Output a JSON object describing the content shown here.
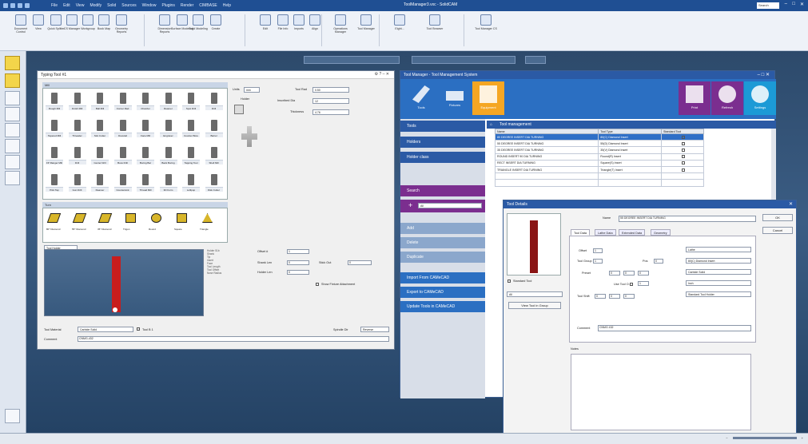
{
  "app": {
    "title": "ToolManager3.vxc - SolidCAM",
    "menu": [
      "File",
      "Edit",
      "View",
      "Modify",
      "Solid",
      "Sources",
      "Window",
      "Plugins",
      "Render",
      "CIMBASE",
      "Help"
    ],
    "search": "Search"
  },
  "ribbon": {
    "buttons": [
      "Document Control",
      "View",
      "Quick Splitter",
      "CS Manager",
      "Workgroup",
      "Book Map",
      "Geometry Reports",
      "Dimension Reports",
      "Surface Modeling",
      "Solid Modeling",
      "Create",
      "Edit",
      "File Info",
      "Imports",
      "Align",
      "Operations Manager",
      "Tool Manager",
      "Eight...",
      "Tool Browser",
      "Tool Manager CS"
    ]
  },
  "typing_window": {
    "title": "Typing Tool #1",
    "mill_label": "Mill",
    "turn_label": "Turn",
    "holder_dropdown": "Tool Holder",
    "mill_tools": [
      "Rough Mill",
      "Finish Mill",
      "Ball Mill",
      "Corner Rad",
      "Chamfer",
      "Reamer",
      "Spot Drill",
      "Drill",
      "Tapered Mill",
      "Threader",
      "Slot Cutter",
      "Dovetail",
      "Face Mill",
      "Engraver",
      "Counter Bore",
      "Barrel",
      "FP Ranger Mill",
      "Drill",
      "Center Drill",
      "Boss Drill",
      "Boring Bar",
      "Back Boring",
      "Tapping Tool",
      "Shell Mill",
      "Pilot Tap",
      "Gun Drill",
      "Reamer",
      "Countersink",
      "Thread Mill",
      "3D Form",
      "Lollipop",
      "Disk Cutter"
    ],
    "turn_inserts": [
      "80° Diamond",
      "55° Diamond",
      "35° Diamond",
      "Trigon",
      "Round",
      "Square",
      "Triangle"
    ],
    "options": {
      "units_label": "Units",
      "units_value": "mm",
      "holder_label": "Holder",
      "tool_rad_label": "Tool Rad",
      "tool_rad_value": "0.50",
      "inscribed_label": "Inscribed Dia",
      "inscribed_value": "12",
      "thickness_label": "Thickness",
      "thickness_value": "4.76"
    },
    "offsets": {
      "offset_label": "Offset #",
      "offset_value": "1",
      "shank_label": "Shank Len",
      "shank_value": "0",
      "holder_len_label": "Holder Len",
      "holder_len_value": "0",
      "stickout_label": "Stick Out",
      "stickout_value": "0",
      "show_fixture": "Show Fixture Attachment"
    },
    "tree_items": [
      "Holder 51b",
      "Shank",
      "Tip",
      "Insert",
      "Face",
      "Tool Length",
      "Tool Offset",
      "Nose Radius"
    ],
    "tool_material_label": "Tool Material",
    "tool_material_value": "Carbide Solid",
    "tool_b_label": "Tool B 1",
    "spindle_label": "Spindle Dir",
    "spindle_value": "Reverse",
    "comment_label": "Comment",
    "comment_value": "CNMG-432"
  },
  "manager_window": {
    "title": "Tool Manager - Tool Management System",
    "top_buttons": [
      "Tools",
      "Fixtures",
      "Equipment"
    ],
    "right_buttons": [
      "Print",
      "Refresh",
      "Settings"
    ],
    "side_items": [
      "Tools",
      "Holders",
      "Holder class"
    ],
    "search_label": "Search",
    "filter_value": "All",
    "grey_items": [
      "Add",
      "Delete",
      "Duplicate"
    ],
    "link_items": [
      "Import From CAMeCAD",
      "Export to CAMeCAD",
      "Update Tools in CAMeCAD"
    ],
    "list_header": "Tool management",
    "columns": [
      "Name",
      "Tool Type",
      "Standard Tool"
    ],
    "rows": [
      {
        "name": "80 DEGREE INSERT DIA TURNING",
        "type": "80(C) Diamond Insert"
      },
      {
        "name": "55 DEGREE INSERT DIA TURNING",
        "type": "55(D) Diamond Insert"
      },
      {
        "name": "35 DEGREE INSERT DIA TURNING",
        "type": "35(V) Diamond Insert"
      },
      {
        "name": "ROUND INSERT 90 DIA TURNING",
        "type": "Round(R) Insert"
      },
      {
        "name": "RECT INSERT DIA TURNING",
        "type": "Square(S) Insert"
      },
      {
        "name": "TRIANGLE INSERT DIA TURNING",
        "type": "Triangle(T) Insert"
      }
    ]
  },
  "details_window": {
    "title": "Tool Details",
    "name_label": "Name",
    "name_value": "55 DEGREE INSERT DIA TURNING",
    "ok": "OK",
    "cancel": "Cancel",
    "tabs": [
      "Tool Data",
      "Lathe Data",
      "Extended Data",
      "Geometry"
    ],
    "standard_tool": "Standard Tool",
    "filter_value": "All",
    "view_btn": "View Tool in Group",
    "offset_label": "Offset",
    "offset_value": "1",
    "tool_group_label": "Tool Group",
    "tool_group_value": "1",
    "pos_label": "Pos",
    "pos_value": "0",
    "preset_label": "Preset",
    "use_tool_label": "Use Tool O.",
    "tool_shift_label": "Tool Shift",
    "zeros": [
      "0",
      "0",
      "0",
      "1",
      "0",
      "0",
      "0"
    ],
    "right_dropdowns": [
      "Lathe",
      "80(C) Diamond Insert",
      "Carbide Solid",
      "Inch",
      "Standard Tool Holder"
    ],
    "comment_label": "Comment",
    "comment_value": "CNMG 432",
    "notes_label": "Notes"
  },
  "colors": {
    "ribbon_bg": "#eef2f8",
    "accent_blue": "#2b5aa5",
    "purple": "#7b2e8f",
    "orange": "#f5a623",
    "teal": "#1c9ad6"
  }
}
